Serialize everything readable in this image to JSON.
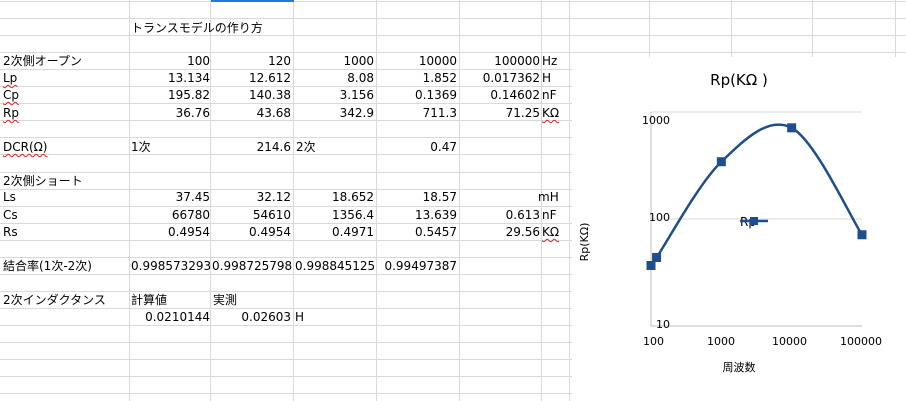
{
  "title": "トランスモデルの作り方",
  "open": {
    "header": [
      "2次側オープン",
      "100",
      "120",
      "1000",
      "10000",
      "100000",
      "Hz"
    ],
    "rows": [
      [
        "Lp",
        "13.134",
        "12.612",
        "8.08",
        "1.852",
        "0.017362",
        "H"
      ],
      [
        "Cp",
        "195.82",
        "140.38",
        "3.156",
        "0.1369",
        "0.14602",
        "nF"
      ],
      [
        "Rp",
        "36.76",
        "43.68",
        "342.9",
        "711.3",
        "71.25",
        "KΩ"
      ]
    ]
  },
  "dcr": {
    "label": "DCR(Ω)",
    "primary_label": "1次",
    "primary_value": "214.6",
    "secondary_label": "2次",
    "secondary_value": "0.47"
  },
  "short": {
    "header": "2次側ショート",
    "rows": [
      [
        "Ls",
        "37.45",
        "32.12",
        "18.652",
        "18.57",
        "",
        "mH"
      ],
      [
        "Cs",
        "66780",
        "54610",
        "1356.4",
        "13.639",
        "0.613",
        "nF"
      ],
      [
        "Rs",
        "0.4954",
        "0.4954",
        "0.4971",
        "0.5457",
        "29.56",
        "KΩ"
      ]
    ]
  },
  "coupling": {
    "label": "結合率(1次-2次)",
    "values": [
      "0.998573293",
      "0.998725798",
      "0.998845125",
      "0.99497387"
    ]
  },
  "inductance": {
    "label": "2次インダクタンス",
    "calc_label": "計算値",
    "meas_label": "実測",
    "calc_value": "0.0210144",
    "meas_value": "0.02603",
    "unit": "H"
  },
  "chart_data": {
    "type": "line",
    "title": "Rp(KΩ )",
    "xlabel": "周波数",
    "ylabel": "Rp(KΩ)",
    "x_scale": "log",
    "y_scale": "log",
    "xlim": [
      100,
      100000
    ],
    "ylim": [
      10,
      1000
    ],
    "x_ticks": [
      "100",
      "1000",
      "10000",
      "100000"
    ],
    "y_ticks": [
      "10",
      "100",
      "1000"
    ],
    "legend_position": "right",
    "series": [
      {
        "name": "Rp",
        "color": "#1f4e8c",
        "x": [
          100,
          120,
          1000,
          10000,
          100000
        ],
        "y": [
          36.76,
          43.68,
          342.9,
          711.3,
          71.25
        ]
      }
    ]
  }
}
